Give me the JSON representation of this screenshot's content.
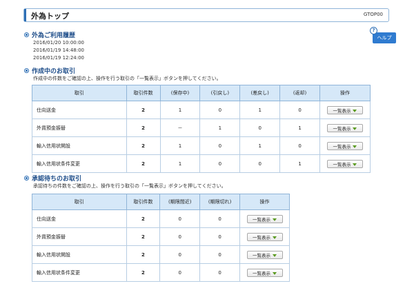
{
  "page": {
    "title": "外為トップ",
    "code": "GTOP00"
  },
  "help": {
    "label": "ヘルプ",
    "icon": "question-icon",
    "icon_glyph": "?"
  },
  "history": {
    "title": "外為ご利用履歴",
    "entries": [
      "2016/01/20 10:00:00",
      "2016/01/19 14:48:00",
      "2016/01/19 12:24:00"
    ]
  },
  "in_progress": {
    "title": "作成中のお取引",
    "description": "作成中の件数をご確認の上、操作を行う取引の「一覧表示」ボタンを押してください。",
    "headers": [
      "取引",
      "取引件数",
      "(保存中)",
      "(引戻し)",
      "(差戻し)",
      "(返却)",
      "操作"
    ],
    "rows": [
      {
        "name": "仕向送金",
        "count": "2",
        "saved": "1",
        "withdrawn": "0",
        "returned": "1",
        "rejected": "0"
      },
      {
        "name": "外貨預金振替",
        "count": "2",
        "saved": "－",
        "withdrawn": "1",
        "returned": "0",
        "rejected": "1"
      },
      {
        "name": "輸入信用状開設",
        "count": "2",
        "saved": "1",
        "withdrawn": "0",
        "returned": "1",
        "rejected": "0"
      },
      {
        "name": "輸入信用状条件変更",
        "count": "2",
        "saved": "1",
        "withdrawn": "0",
        "returned": "0",
        "rejected": "1"
      }
    ],
    "button_label": "一覧表示"
  },
  "awaiting": {
    "title": "承認待ちのお取引",
    "description": "承認待ちの件数をご確認の上、操作を行う取引の「一覧表示」ボタンを押してください。",
    "headers": [
      "取引",
      "取引件数",
      "(期限間近)",
      "(期限切れ)",
      "操作"
    ],
    "rows": [
      {
        "name": "仕向送金",
        "count": "2",
        "near": "0",
        "expired": "0"
      },
      {
        "name": "外貨預金振替",
        "count": "2",
        "near": "0",
        "expired": "0"
      },
      {
        "name": "輸入信用状開設",
        "count": "2",
        "near": "0",
        "expired": "0"
      },
      {
        "name": "輸入信用状条件変更",
        "count": "2",
        "near": "0",
        "expired": "0"
      }
    ],
    "button_label": "一覧表示"
  },
  "colors": {
    "accent": "#2e6fb5",
    "header_bg": "#d6e8f8",
    "help_bg": "#2f7bd0",
    "triangle": "#5a9a1e"
  }
}
